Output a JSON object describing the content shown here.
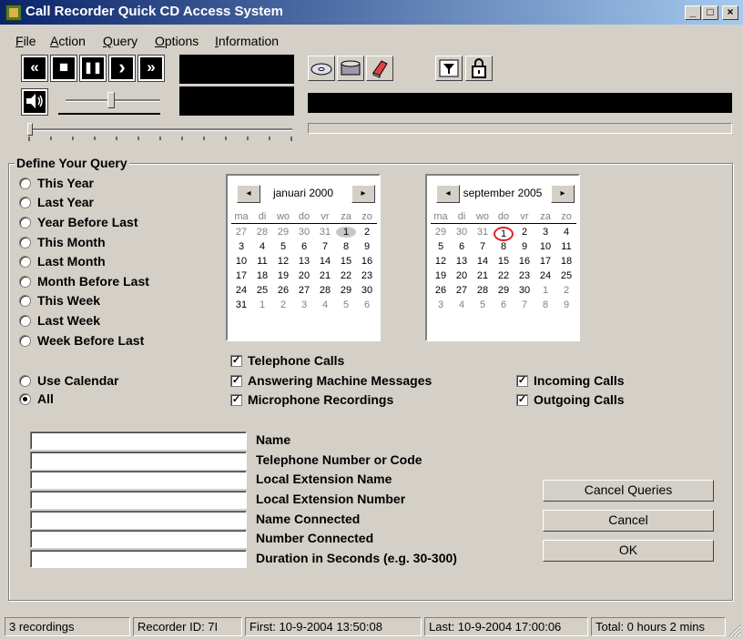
{
  "window": {
    "title": "Call Recorder Quick CD Access System",
    "minimize": "_",
    "maximize": "□",
    "close": "×"
  },
  "menu": [
    "File",
    "Action",
    "Query",
    "Options",
    "Information"
  ],
  "menu_mnemonics": [
    "F",
    "A",
    "Q",
    "O",
    "I"
  ],
  "transport": {
    "rewind": "«",
    "stop": "■",
    "pause": "❚❚",
    "play": "›",
    "forward": "»"
  },
  "query": {
    "legend": "Define Your Query",
    "radios": [
      {
        "label": "This Year",
        "checked": false
      },
      {
        "label": "Last Year",
        "checked": false
      },
      {
        "label": "Year Before Last",
        "checked": false
      },
      {
        "label": "This Month",
        "checked": false
      },
      {
        "label": "Last Month",
        "checked": false
      },
      {
        "label": "Month Before Last",
        "checked": false
      },
      {
        "label": "This Week",
        "checked": false
      },
      {
        "label": "Last Week",
        "checked": false
      },
      {
        "label": "Week Before Last",
        "checked": false
      }
    ],
    "radio_calendar": {
      "label": "Use Calendar",
      "checked": false
    },
    "radio_all": {
      "label": "All",
      "checked": true
    },
    "checks": {
      "telephone": {
        "label": "Telephone Calls",
        "checked": true
      },
      "answering": {
        "label": "Answering Machine Messages",
        "checked": true
      },
      "microphone": {
        "label": "Microphone Recordings",
        "checked": true
      },
      "incoming": {
        "label": "Incoming Calls",
        "checked": true
      },
      "outgoing": {
        "label": "Outgoing Calls",
        "checked": true
      }
    },
    "check_mark": "✓"
  },
  "calendars": [
    {
      "month": "januari 2000",
      "prev": "◂",
      "next": "▸",
      "dow": [
        "ma",
        "di",
        "wo",
        "do",
        "vr",
        "za",
        "zo"
      ],
      "rows": [
        [
          "27",
          "28",
          "29",
          "30",
          "31",
          "1",
          "2"
        ],
        [
          "3",
          "4",
          "5",
          "6",
          "7",
          "8",
          "9"
        ],
        [
          "10",
          "11",
          "12",
          "13",
          "14",
          "15",
          "16"
        ],
        [
          "17",
          "18",
          "19",
          "20",
          "21",
          "22",
          "23"
        ],
        [
          "24",
          "25",
          "26",
          "27",
          "28",
          "29",
          "30"
        ],
        [
          "31",
          "1",
          "2",
          "3",
          "4",
          "5",
          "6"
        ]
      ],
      "gray": [
        [
          0,
          0
        ],
        [
          0,
          1
        ],
        [
          0,
          2
        ],
        [
          0,
          3
        ],
        [
          0,
          4
        ],
        [
          5,
          1
        ],
        [
          5,
          2
        ],
        [
          5,
          3
        ],
        [
          5,
          4
        ],
        [
          5,
          5
        ],
        [
          5,
          6
        ]
      ],
      "selected": [
        0,
        5
      ],
      "today": null
    },
    {
      "month": "september 2005",
      "prev": "◂",
      "next": "▸",
      "dow": [
        "ma",
        "di",
        "wo",
        "do",
        "vr",
        "za",
        "zo"
      ],
      "rows": [
        [
          "29",
          "30",
          "31",
          "1",
          "2",
          "3",
          "4"
        ],
        [
          "5",
          "6",
          "7",
          "8",
          "9",
          "10",
          "11"
        ],
        [
          "12",
          "13",
          "14",
          "15",
          "16",
          "17",
          "18"
        ],
        [
          "19",
          "20",
          "21",
          "22",
          "23",
          "24",
          "25"
        ],
        [
          "26",
          "27",
          "28",
          "29",
          "30",
          "1",
          "2"
        ],
        [
          "3",
          "4",
          "5",
          "6",
          "7",
          "8",
          "9"
        ]
      ],
      "gray": [
        [
          0,
          0
        ],
        [
          0,
          1
        ],
        [
          0,
          2
        ],
        [
          4,
          5
        ],
        [
          4,
          6
        ],
        [
          5,
          0
        ],
        [
          5,
          1
        ],
        [
          5,
          2
        ],
        [
          5,
          3
        ],
        [
          5,
          4
        ],
        [
          5,
          5
        ],
        [
          5,
          6
        ]
      ],
      "selected": null,
      "today": [
        0,
        3
      ]
    }
  ],
  "fields": [
    {
      "label": "Name",
      "value": ""
    },
    {
      "label": "Telephone Number or Code",
      "value": ""
    },
    {
      "label": "Local Extension Name",
      "value": ""
    },
    {
      "label": "Local Extension Number",
      "value": ""
    },
    {
      "label": "Name Connected",
      "value": ""
    },
    {
      "label": "Number Connected",
      "value": ""
    },
    {
      "label": "Duration in Seconds (e.g. 30-300)",
      "value": ""
    }
  ],
  "buttons": {
    "cancel_queries": "Cancel Queries",
    "cancel": "Cancel",
    "ok": "OK"
  },
  "status": {
    "recordings": "3 recordings",
    "recorder_id": "Recorder ID: 7I",
    "first": "First:  10-9-2004 13:50:08",
    "last": "Last:  10-9-2004 17:00:06",
    "total": "Total: 0 hours 2 mins"
  }
}
